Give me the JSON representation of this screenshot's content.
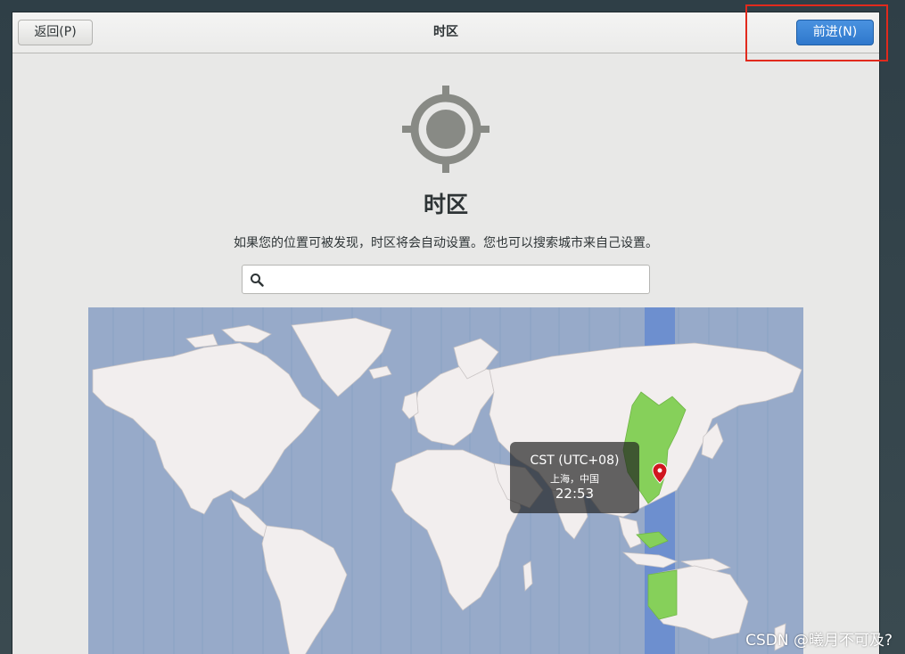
{
  "header": {
    "back_label": "返回(P)",
    "title": "时区",
    "next_label": "前进(N)"
  },
  "main": {
    "title": "时区",
    "description": "如果您的位置可被发现，时区将会自动设置。您也可以搜索城市来自己设置。",
    "search": {
      "value": "",
      "placeholder": ""
    }
  },
  "map": {
    "tooltip": {
      "zone": "CST (UTC+08)",
      "city": "上海，中国",
      "time": "22:53"
    }
  },
  "icons": {
    "location": "locate-crosshair-icon",
    "search": "magnifier-icon",
    "pin": "map-pin-icon"
  },
  "colors": {
    "accent": "#3584e4",
    "highlight_box": "#e12a1d",
    "ocean": "#97aac9",
    "land": "#f2eeee",
    "selected_zone": "#86d05a",
    "selected_band": "#6d8fcf"
  },
  "watermark": "CSDN @曦月不可及?"
}
